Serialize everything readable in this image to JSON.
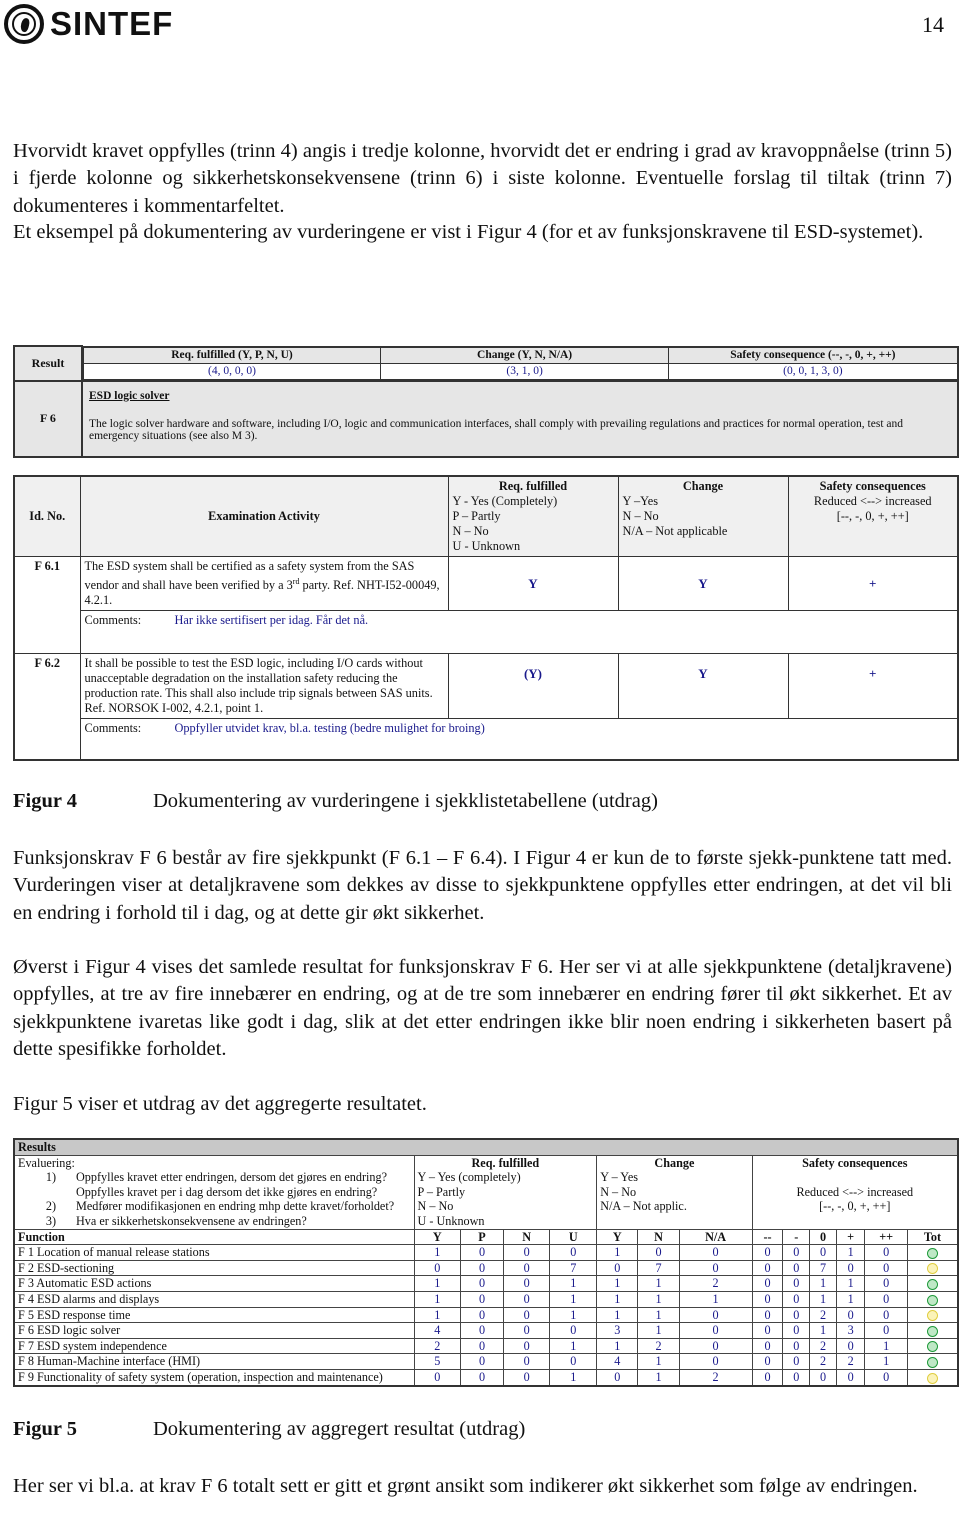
{
  "header": {
    "logo_text": "SINTEF",
    "page_number": "14"
  },
  "paragraphs": {
    "p1": "Hvorvidt kravet oppfylles (trinn 4) angis i tredje kolonne, hvorvidt det er endring i grad av kravoppnåelse (trinn 5) i fjerde kolonne og sikkerhetskonsekvensene (trinn 6) i siste kolonne. Eventuelle forslag til tiltak (trinn 7) dokumenteres i kommentarfeltet.",
    "p2": "Et eksempel på dokumentering av vurderingene er vist i Figur 4 (for et av funksjonskravene til ESD-systemet).",
    "p3": "Funksjonskrav F 6 består av fire sjekkpunkt (F 6.1 – F 6.4). I Figur 4 er kun de to første sjekk-punktene tatt med. Vurderingen viser at detaljkravene som dekkes av disse to sjekkpunktene oppfylles etter endringen, at det vil bli en endring i forhold til i dag, og at dette gir økt sikkerhet.",
    "p4": "Øverst i Figur 4 vises det samlede resultat for funksjonskrav F 6. Her ser vi at alle sjekkpunktene (detaljkravene) oppfylles, at tre av fire innebærer en endring, og at de tre som innebærer en endring fører til økt sikkerhet. Et av sjekkpunktene ivaretas like godt i dag, slik at det etter endringen ikke blir noen endring i sikkerheten basert på dette spesifikke forholdet.",
    "p5": "Figur 5 viser et utdrag av det aggregerte resultatet.",
    "p6": "Her ser vi bl.a. at krav F 6 totalt sett er gitt et grønt ansikt som indikerer økt sikkerhet som følge av endringen."
  },
  "figure4": {
    "result": {
      "label_result": "Result",
      "label_id": "F 6",
      "headers": [
        "Req. fulfilled (Y, P, N, U)",
        "Change (Y, N, N/A)",
        "Safety consequence (--, -, 0, +, ++)"
      ],
      "values": [
        "(4, 0, 0, 0)",
        "(3, 1, 0)",
        "(0, 0, 1, 3, 0)"
      ],
      "title": "ESD logic solver",
      "description": "The logic solver hardware and software, including I/O, logic and communication interfaces, shall comply with prevailing regulations and practices for normal operation, test and emergency situations (see also M 3)."
    },
    "checklist": {
      "col_id": "Id. No.",
      "col_activity": "Examination Activity",
      "col_req": {
        "title": "Req. fulfilled",
        "lines": [
          "Y - Yes (Completely)",
          "P – Partly",
          "N – No",
          "U - Unknown"
        ]
      },
      "col_change": {
        "title": "Change",
        "lines": [
          "Y –Yes",
          "N – No",
          "N/A – Not applicable"
        ]
      },
      "col_safety": {
        "title": "Safety consequences",
        "lines": [
          "Reduced <--> increased",
          "[--, -, 0, +, ++]"
        ]
      },
      "comments_label": "Comments:",
      "rows": [
        {
          "id": "F 6.1",
          "activity_a": "The ESD system shall be certified as a safety system from the SAS vendor and shall have been verified by a 3",
          "activity_sup": "rd",
          "activity_b": " party. Ref. NHT-I52-00049, 4.2.1.",
          "req": "Y",
          "change": "Y",
          "safety": "+",
          "comment": "Har ikke sertifisert per idag. Får det nå."
        },
        {
          "id": "F 6.2",
          "activity_a": "It shall be possible to test the ESD logic, including I/O cards without unacceptable degradation on the installation safety reducing the production rate. This shall also include trip signals between SAS units. Ref. NORSOK I-002, 4.2.1, point 1.",
          "activity_sup": "",
          "activity_b": "",
          "req": "(Y)",
          "change": "Y",
          "safety": "+",
          "comment": "Oppfyller utvidet krav, bl.a. testing (bedre mulighet for broing)"
        }
      ]
    },
    "caption_label": "Figur 4",
    "caption_text": "Dokumentering av vurderingene i sjekklistetabellene (utdrag)"
  },
  "figure5": {
    "title": "Results",
    "eval_label": "Evaluering:",
    "eval_items": [
      {
        "num": "1)",
        "text": "Oppfylles kravet etter endringen, dersom det gjøres en endring?"
      },
      {
        "num": "",
        "text": "Oppfylles kravet per i dag dersom det ikke gjøres en endring?"
      },
      {
        "num": "2)",
        "text": "Medfører modifikasjonen en endring mhp dette kravet/forholdet?"
      },
      {
        "num": "3)",
        "text": "Hva er sikkerhetskonsekvensene av endringen?"
      }
    ],
    "req": {
      "title": "Req. fulfilled",
      "lines": [
        "Y – Yes (completely)",
        "P – Partly",
        "N – No",
        "U - Unknown"
      ]
    },
    "change": {
      "title": "Change",
      "lines": [
        "Y – Yes",
        "N – No",
        "N/A – Not applic."
      ]
    },
    "safety": {
      "title": "Safety consequences",
      "lines": [
        "Reduced <--> increased",
        "[--, -, 0, +, ++]"
      ]
    },
    "columns": [
      "Function",
      "Y",
      "P",
      "N",
      "U",
      "Y",
      "N",
      "N/A",
      "--",
      "-",
      "0",
      "+",
      "++",
      "Tot"
    ],
    "rows": [
      {
        "name": "F 1 Location of manual release stations",
        "v": [
          1,
          0,
          0,
          0,
          1,
          0,
          0,
          0,
          0,
          0,
          1,
          0
        ],
        "tot": "green"
      },
      {
        "name": "F 2 ESD-sectioning",
        "v": [
          0,
          0,
          0,
          7,
          0,
          7,
          0,
          0,
          0,
          7,
          0,
          0
        ],
        "tot": "yellow"
      },
      {
        "name": "F 3 Automatic ESD actions",
        "v": [
          1,
          0,
          0,
          1,
          1,
          1,
          2,
          0,
          0,
          1,
          1,
          0
        ],
        "tot": "green"
      },
      {
        "name": "F 4 ESD alarms and displays",
        "v": [
          1,
          0,
          0,
          1,
          1,
          1,
          1,
          0,
          0,
          1,
          1,
          0
        ],
        "tot": "green"
      },
      {
        "name": "F 5 ESD response time",
        "v": [
          1,
          0,
          0,
          1,
          1,
          1,
          0,
          0,
          0,
          2,
          0,
          0
        ],
        "tot": "yellow"
      },
      {
        "name": "F 6 ESD logic solver",
        "v": [
          4,
          0,
          0,
          0,
          3,
          1,
          0,
          0,
          0,
          1,
          3,
          0
        ],
        "tot": "green"
      },
      {
        "name": "F 7 ESD system independence",
        "v": [
          2,
          0,
          0,
          1,
          1,
          2,
          0,
          0,
          0,
          2,
          0,
          1
        ],
        "tot": "green"
      },
      {
        "name": "F 8 Human-Machine interface (HMI)",
        "v": [
          5,
          0,
          0,
          0,
          4,
          1,
          0,
          0,
          0,
          2,
          2,
          1
        ],
        "tot": "green"
      },
      {
        "name": "F 9 Functionality of safety system (operation, inspection and maintenance)",
        "v": [
          0,
          0,
          0,
          1,
          0,
          1,
          2,
          0,
          0,
          0,
          0,
          0
        ],
        "tot": "yellow"
      }
    ],
    "caption_label": "Figur 5",
    "caption_text": "Dokumentering av aggregert resultat (utdrag)"
  }
}
